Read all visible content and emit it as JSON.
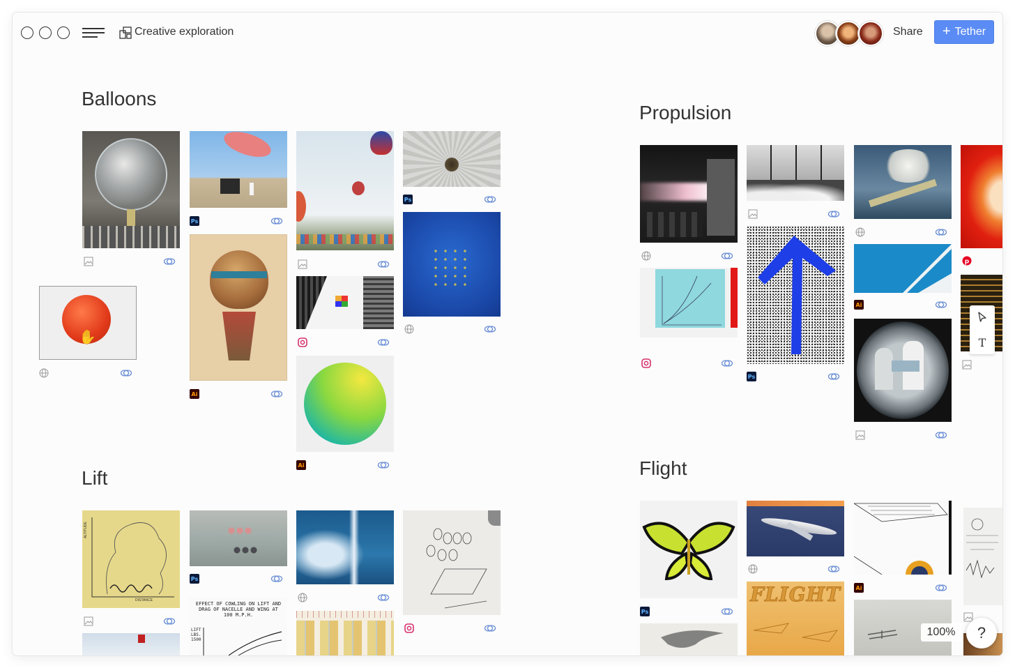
{
  "window": {
    "title": "Creative exploration"
  },
  "header": {
    "share_label": "Share",
    "tether_label": "Tether",
    "avatars": [
      "collaborator-1",
      "collaborator-2",
      "collaborator-3"
    ]
  },
  "sections": [
    {
      "id": "balloons",
      "title": "Balloons"
    },
    {
      "id": "propulsion",
      "title": "Propulsion"
    },
    {
      "id": "lift",
      "title": "Lift"
    },
    {
      "id": "flight",
      "title": "Flight"
    }
  ],
  "cards": [
    {
      "section": "balloons",
      "thumb": "glass-balloon",
      "source": "image-icon"
    },
    {
      "section": "balloons",
      "thumb": "red-balloon-dragging",
      "source": "globe-icon"
    },
    {
      "section": "balloons",
      "thumb": "pink-blimp",
      "source": "Ps"
    },
    {
      "section": "balloons",
      "thumb": "vintage-balloon",
      "source": "Ai"
    },
    {
      "section": "balloons",
      "thumb": "hot-air-balloons",
      "source": "image-icon"
    },
    {
      "section": "balloons",
      "thumb": "buildings-cube",
      "source": "instagram-icon"
    },
    {
      "section": "balloons",
      "thumb": "green-gradient-sphere",
      "source": "Ai"
    },
    {
      "section": "balloons",
      "thumb": "parachute-top",
      "source": "Ps"
    },
    {
      "section": "balloons",
      "thumb": "blue-sky-balloons",
      "source": "globe-icon"
    },
    {
      "section": "propulsion",
      "thumb": "jet-engine",
      "source": "globe-icon"
    },
    {
      "section": "propulsion",
      "thumb": "cyan-graph",
      "source": "instagram-icon"
    },
    {
      "section": "propulsion",
      "thumb": "rocket-launches",
      "source": "image-icon"
    },
    {
      "section": "propulsion",
      "thumb": "blue-arrow",
      "source": "Ps"
    },
    {
      "section": "propulsion",
      "thumb": "plane-smoke",
      "source": "globe-icon"
    },
    {
      "section": "propulsion",
      "thumb": "blue-geometric",
      "source": "Ai"
    },
    {
      "section": "propulsion",
      "thumb": "engineers-porthole",
      "source": "image-icon"
    },
    {
      "section": "propulsion",
      "thumb": "red-rocket-art",
      "source": "pinterest-icon"
    },
    {
      "section": "propulsion",
      "thumb": "city-night",
      "source": "image-icon"
    },
    {
      "section": "lift",
      "thumb": "altitude-chart",
      "source": "image-icon"
    },
    {
      "section": "lift",
      "thumb": "grey-balloons",
      "source": "Ps"
    },
    {
      "section": "lift",
      "thumb": "lift-diagram",
      "source": "none"
    },
    {
      "section": "lift",
      "thumb": "blue-clouds",
      "source": "globe-icon"
    },
    {
      "section": "lift",
      "thumb": "yellow-bars",
      "source": "none"
    },
    {
      "section": "lift",
      "thumb": "wing-sketch",
      "source": "instagram-icon"
    },
    {
      "section": "flight",
      "thumb": "green-butterfly",
      "source": "Ps"
    },
    {
      "section": "flight",
      "thumb": "hawk-sketch",
      "source": "none"
    },
    {
      "section": "flight",
      "thumb": "airliner",
      "source": "globe-icon"
    },
    {
      "section": "flight",
      "thumb": "flight-poster",
      "source": "none"
    },
    {
      "section": "flight",
      "thumb": "plane-drawing",
      "source": "Ai"
    },
    {
      "section": "flight",
      "thumb": "old-biplane",
      "source": "none"
    },
    {
      "section": "flight",
      "thumb": "mechanical-sketch",
      "source": "image-icon"
    }
  ],
  "lift_diagram_text": "EFFECT OF COWLING ON LIFT AND DRAG OF NACELLE AND WING AT 100 M.P.H.",
  "lift_diagram_axis": "LIFT LBS. 1500",
  "altitude_chart_axis": "ALTITUDE",
  "altitude_chart_xaxis": "DISTANCE",
  "flight_poster_text": "FLIGHT",
  "badges": {
    "ps": "Ps",
    "ai": "Ai"
  },
  "zoom": "100%",
  "help": "?",
  "tools": {
    "select": "pointer-icon",
    "text": "T"
  },
  "colors": {
    "accent": "#5b8cf5",
    "link": "#6b8fd6",
    "text": "#333333"
  }
}
